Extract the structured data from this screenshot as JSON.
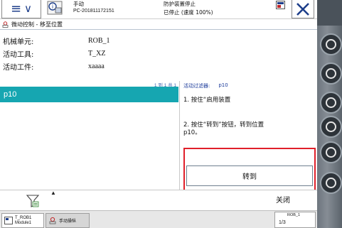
{
  "header": {
    "mode": "手动",
    "host": "PC-201811172151",
    "safety": "防护装置停止",
    "status": "已停止 (速度 100%)"
  },
  "breadcrumb": "微动控制 - 移至位置",
  "info": {
    "rows": [
      {
        "label": "机械单元:",
        "value": "ROB_1"
      },
      {
        "label": "活动工具:",
        "value": "T_XZ"
      },
      {
        "label": "活动工件:",
        "value": "xaaaa"
      }
    ]
  },
  "list": {
    "count_text": "1 到 1 共 1",
    "items": [
      "p10"
    ]
  },
  "right_pane": {
    "filter_label": "活动过滤器:",
    "filter_value": "p10",
    "step1": "1. 按住“启用装置",
    "step2_line1": "2. 按住“转到”按钮，转到位置",
    "step2_line2": "p10。",
    "goto_button": "转到"
  },
  "toolbar": {
    "close_label": "关闭"
  },
  "taskbar": {
    "task1_line1": "T_ROB1",
    "task1_line2": "Module1",
    "task2_label": "手动操纵",
    "qs_label": "ROB_1",
    "qs_sub": "1/3"
  },
  "colors": {
    "selection": "#16a6b1",
    "highlight": "#e0202a",
    "header_blue": "#1d3e8a"
  }
}
